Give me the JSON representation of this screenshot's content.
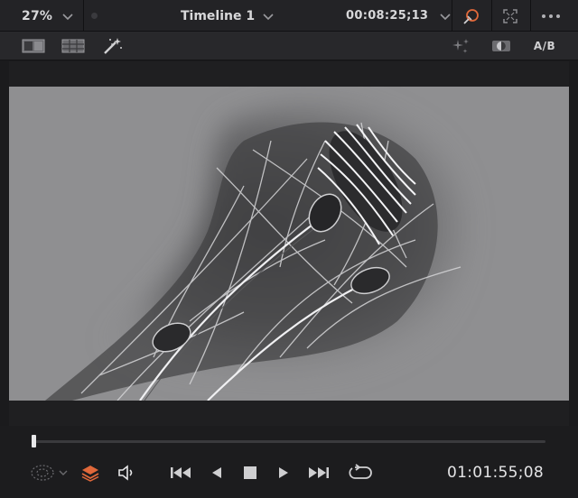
{
  "header": {
    "zoom": "27%",
    "timeline_name": "Timeline 1",
    "timecode": "00:08:25;13"
  },
  "toolbar": {
    "ab_label": "A/B"
  },
  "transport": {
    "timecode": "01:01:55;08",
    "progress": 0.0
  },
  "icons": [
    "viewer-layout-icon",
    "grid-icon",
    "magic-wand-icon",
    "sparkle-icon",
    "mask-icon",
    "color-picker-icon",
    "fullscreen-icon",
    "more-icon",
    "clip-overlay-icon",
    "layers-icon",
    "volume-icon",
    "skip-start-icon",
    "play-reverse-icon",
    "stop-icon",
    "play-icon",
    "skip-end-icon",
    "loop-icon"
  ],
  "colors": {
    "accent_orange": "#e0683a",
    "background": "#1b1b1d",
    "viewer_grey": "#8f8f91"
  }
}
